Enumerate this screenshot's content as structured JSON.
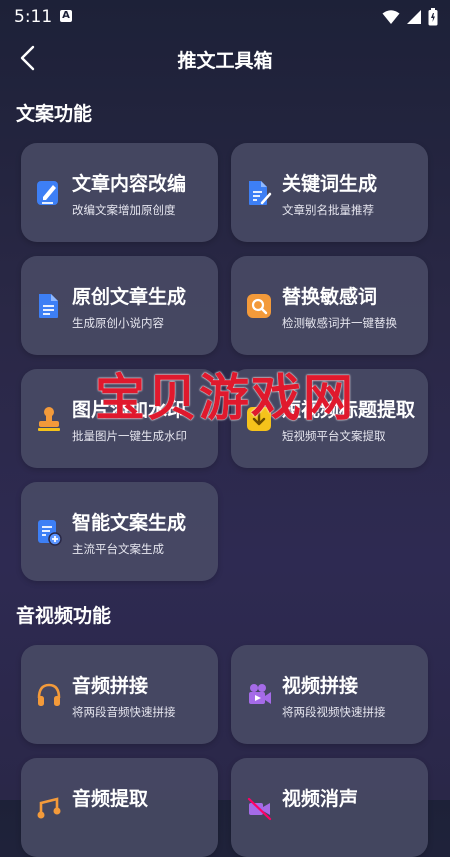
{
  "status": {
    "time": "5:11",
    "a_badge": "A"
  },
  "header": {
    "title": "推文工具箱"
  },
  "sections": [
    {
      "title": "文案功能"
    },
    {
      "title": "音视频功能"
    }
  ],
  "cards": [
    {
      "title": "文章内容改编",
      "subtitle": "改编文案增加原创度",
      "icon": "edit-doc-icon"
    },
    {
      "title": "关键词生成",
      "subtitle": "文章别名批量推荐",
      "icon": "keyword-doc-icon"
    },
    {
      "title": "原创文章生成",
      "subtitle": "生成原创小说内容",
      "icon": "article-doc-icon"
    },
    {
      "title": "替换敏感词",
      "subtitle": "检测敏感词并一键替换",
      "icon": "search-replace-icon"
    },
    {
      "title": "图片添加水印",
      "subtitle": "批量图片一键生成水印",
      "icon": "stamp-icon"
    },
    {
      "title": "短视频标题提取",
      "subtitle": "短视频平台文案提取",
      "icon": "extract-icon"
    },
    {
      "title": "智能文案生成",
      "subtitle": "主流平台文案生成",
      "icon": "smart-doc-icon"
    },
    {
      "title": "音频拼接",
      "subtitle": "将两段音频快速拼接",
      "icon": "headphones-icon"
    },
    {
      "title": "视频拼接",
      "subtitle": "将两段视频快速拼接",
      "icon": "video-camera-icon"
    },
    {
      "title": "音频提取",
      "subtitle": "",
      "icon": "audio-extract-icon"
    },
    {
      "title": "视频消声",
      "subtitle": "",
      "icon": "video-mute-icon"
    }
  ],
  "watermark": {
    "text": "宝贝游戏网"
  },
  "colors": {
    "blue": "#3d7ff5",
    "orange": "#f39a3a",
    "purple": "#a56be8",
    "yellow": "#f5c21b"
  }
}
